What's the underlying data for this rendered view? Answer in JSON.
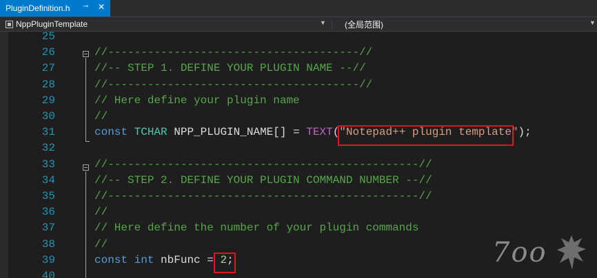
{
  "tab": {
    "title": "PluginDefinition.h",
    "pin_glyph": "⊸",
    "close_glyph": "✕"
  },
  "navbar": {
    "project": "NppPluginTemplate",
    "scope": "(全局范围)",
    "dropdown_glyph": "▼"
  },
  "line_numbers": [
    "25",
    "26",
    "27",
    "28",
    "29",
    "30",
    "31",
    "32",
    "33",
    "34",
    "35",
    "36",
    "37",
    "38",
    "39",
    "40"
  ],
  "lines": [
    [],
    [
      {
        "t": "//--------------------------------------//",
        "c": "cm"
      }
    ],
    [
      {
        "t": "//-- STEP 1. DEFINE YOUR PLUGIN NAME --//",
        "c": "cm"
      }
    ],
    [
      {
        "t": "//--------------------------------------//",
        "c": "cm"
      }
    ],
    [
      {
        "t": "// Here define your plugin name",
        "c": "cm"
      }
    ],
    [
      {
        "t": "//",
        "c": "cm"
      }
    ],
    [
      {
        "t": "const",
        "c": "kw"
      },
      {
        "t": " ",
        "c": "id"
      },
      {
        "t": "TCHAR",
        "c": "ty"
      },
      {
        "t": " NPP_PLUGIN_NAME[] = ",
        "c": "id"
      },
      {
        "t": "TEXT",
        "c": "mac"
      },
      {
        "t": "(",
        "c": "id"
      },
      {
        "t": "\"Notepad++ plugin template\"",
        "c": "str"
      },
      {
        "t": ");",
        "c": "id"
      }
    ],
    [],
    [
      {
        "t": "//-----------------------------------------------//",
        "c": "cm"
      }
    ],
    [
      {
        "t": "//-- STEP 2. DEFINE YOUR PLUGIN COMMAND NUMBER --//",
        "c": "cm"
      }
    ],
    [
      {
        "t": "//-----------------------------------------------//",
        "c": "cm"
      }
    ],
    [
      {
        "t": "//",
        "c": "cm"
      }
    ],
    [
      {
        "t": "// Here define the number of your plugin commands",
        "c": "cm"
      }
    ],
    [
      {
        "t": "//",
        "c": "cm"
      }
    ],
    [
      {
        "t": "const",
        "c": "kw"
      },
      {
        "t": " ",
        "c": "id"
      },
      {
        "t": "int",
        "c": "kw"
      },
      {
        "t": " nbFunc = ",
        "c": "id"
      },
      {
        "t": "2",
        "c": "num"
      },
      {
        "t": ";",
        "c": "id"
      }
    ],
    []
  ],
  "watermark": {
    "text": "7oo"
  },
  "colors": {
    "accent": "#007acc",
    "highlight": "#e81123",
    "comment": "#57a64a",
    "keyword": "#569cd6",
    "type": "#4ec9b0",
    "string": "#d69d85",
    "macro": "#bd63c5",
    "linenumber": "#2b91af"
  }
}
